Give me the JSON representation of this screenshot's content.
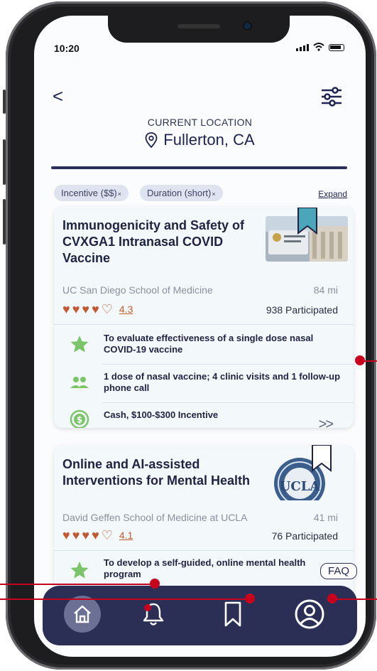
{
  "status": {
    "time": "10:20"
  },
  "header": {
    "back_glyph": "<",
    "location_label": "CURRENT LOCATION",
    "location_name": "Fullerton, CA",
    "icons": {
      "back": "back-chevron-icon",
      "filter": "filter-sliders-icon",
      "location": "location-pin-icon"
    }
  },
  "filters": {
    "chips": [
      {
        "label": "Incentive ($$)",
        "remove": "×"
      },
      {
        "label": "Duration (short)",
        "remove": "×"
      }
    ],
    "expand_label": "Expand"
  },
  "studies": [
    {
      "title": "Immunogenicity and Safety of CVXGA1 Intranasal COVID Vaccine",
      "institution": "UC San Diego School of Medicine",
      "distance": "84 mi",
      "rating_label": "4.3",
      "rating_hearts_filled": 4,
      "rating_hearts_total": 5,
      "participated": "938 Participated",
      "purpose": "To evaluate effectiveness of a single dose nasal COVID-19 vaccine",
      "procedure": "1 dose of nasal vaccine; 4 clinic visits and 1 follow-up phone call",
      "incentive": "Cash, $100-$300 Incentive",
      "more_glyph": ">>"
    },
    {
      "title": "Online and AI-assisted Interventions for Mental Health",
      "institution": "David Geffen School of Medicine at UCLA",
      "distance": "41 mi",
      "rating_label": "4.1",
      "rating_hearts_filled": 4,
      "rating_hearts_total": 5,
      "participated": "76 Participated",
      "purpose": "To develop a self-guided, online mental health program",
      "thumb_text": "UCLA"
    }
  ],
  "faq_label": "FAQ",
  "tabbar": {
    "items": [
      {
        "name": "home",
        "icon": "home-icon",
        "active": true
      },
      {
        "name": "notifications",
        "icon": "bell-icon",
        "active": false
      },
      {
        "name": "saved",
        "icon": "bookmark-icon",
        "active": false
      },
      {
        "name": "profile",
        "icon": "user-circle-icon",
        "active": false
      }
    ]
  },
  "colors": {
    "navy": "#2b2f55",
    "accent_rust": "#c15a32",
    "star_green": "#7cc46a",
    "card_bg": "#f3f8fb",
    "annotation_red": "#c8001e"
  }
}
